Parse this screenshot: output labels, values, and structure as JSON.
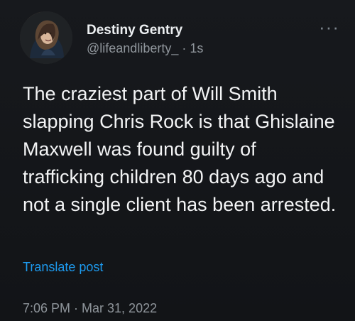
{
  "tweet": {
    "author": {
      "display_name": "Destiny Gentry",
      "handle": "@lifeandliberty_",
      "separator": " · ",
      "relative_time": "1s"
    },
    "more_icon": "more-horizontal-icon",
    "text": "The craziest part of Will Smith slapping Chris Rock is that Ghislaine Maxwell was found guilty of trafficking children 80 days ago and not a single client has been arrested.",
    "translate_label": "Translate post",
    "timestamp": "7:06 PM · Mar 31, 2022"
  },
  "colors": {
    "background": "#15181c",
    "text": "#e7e9ea",
    "muted": "#8e949a",
    "accent": "#1d9bf0"
  }
}
